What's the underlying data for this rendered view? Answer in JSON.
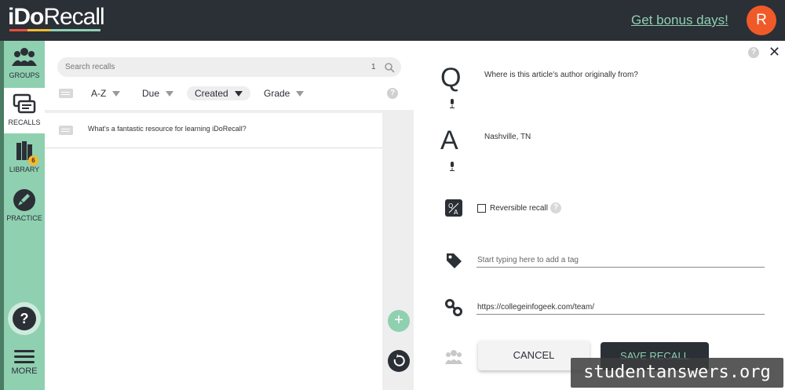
{
  "header": {
    "logo_bold": "iDo",
    "logo_light": "Recall",
    "bonus_link": "Get bonus days!",
    "avatar_initial": "R"
  },
  "nav": {
    "items": [
      {
        "label": "GROUPS",
        "icon": "groups-icon"
      },
      {
        "label": "RECALLS",
        "icon": "recalls-icon",
        "active": true
      },
      {
        "label": "LIBRARY",
        "icon": "library-icon",
        "badge": "6"
      },
      {
        "label": "PRACTICE",
        "icon": "practice-icon"
      }
    ],
    "help": "?",
    "more": "MORE"
  },
  "list": {
    "search_placeholder": "Search recalls",
    "count": "1",
    "sort": {
      "az": "A-Z",
      "due": "Due",
      "created": "Created",
      "grade": "Grade",
      "selected": "Created"
    },
    "help": "?",
    "rows": [
      {
        "text": "What's a fantastic resource for learning iDoRecall?"
      }
    ]
  },
  "fab": {
    "add": "+"
  },
  "editor": {
    "help": "?",
    "close": "✕",
    "q_letter": "Q",
    "question": "Where is this article's author originally from?",
    "a_letter": "A",
    "answer": "Nashville, TN",
    "reversible_label": "Reversible recall",
    "reversible_checked": false,
    "reversible_help": "?",
    "tag_placeholder": "Start typing here to add a tag",
    "link_value": "https://collegeinfogeek.com/team/",
    "cancel": "CANCEL",
    "save": "SAVE RECALL"
  },
  "watermark": "studentanswers.org",
  "colors": {
    "topbar": "#2b2f36",
    "accent_green": "#8fd0b1",
    "avatar": "#f05a28",
    "badge": "#f5b82e"
  }
}
